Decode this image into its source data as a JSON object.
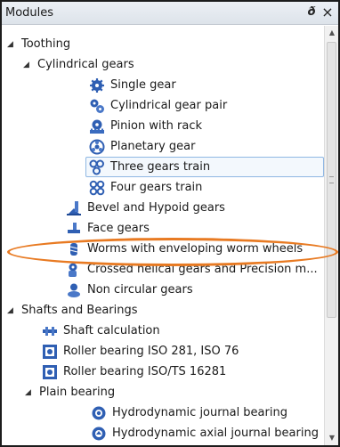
{
  "panel": {
    "title": "Modules",
    "float_button": "ð",
    "close_button": "×"
  },
  "tree": {
    "toothing": "Toothing",
    "cylindrical_gears": "Cylindrical gears",
    "single_gear": "Single gear",
    "cylindrical_gear_pair": "Cylindrical gear pair",
    "pinion_with_rack": "Pinion with rack",
    "planetary_gear": "Planetary gear",
    "three_gears_train": "Three gears train",
    "four_gears_train": "Four gears train",
    "bevel_hypoid_gears": "Bevel and Hypoid gears",
    "face_gears": "Face gears",
    "worms_enveloping": "Worms with enveloping worm wheels",
    "crossed_helical": "Crossed helical gears and Precision m...",
    "non_circular_gears": "Non circular gears",
    "shafts_and_bearings": "Shafts and Bearings",
    "shaft_calculation": "Shaft calculation",
    "roller_bearing_iso_281": "Roller bearing ISO 281, ISO 76",
    "roller_bearing_iso_ts": "Roller bearing ISO/TS 16281",
    "plain_bearing": "Plain bearing",
    "hydrodynamic_journal": "Hydrodynamic journal bearing",
    "hydrodynamic_axial": "Hydrodynamic axial journal bearing"
  },
  "colors": {
    "gear_blue": "#2f5fb3",
    "highlight_orange": "#e87a22",
    "selection_border": "#8fb7e3"
  }
}
